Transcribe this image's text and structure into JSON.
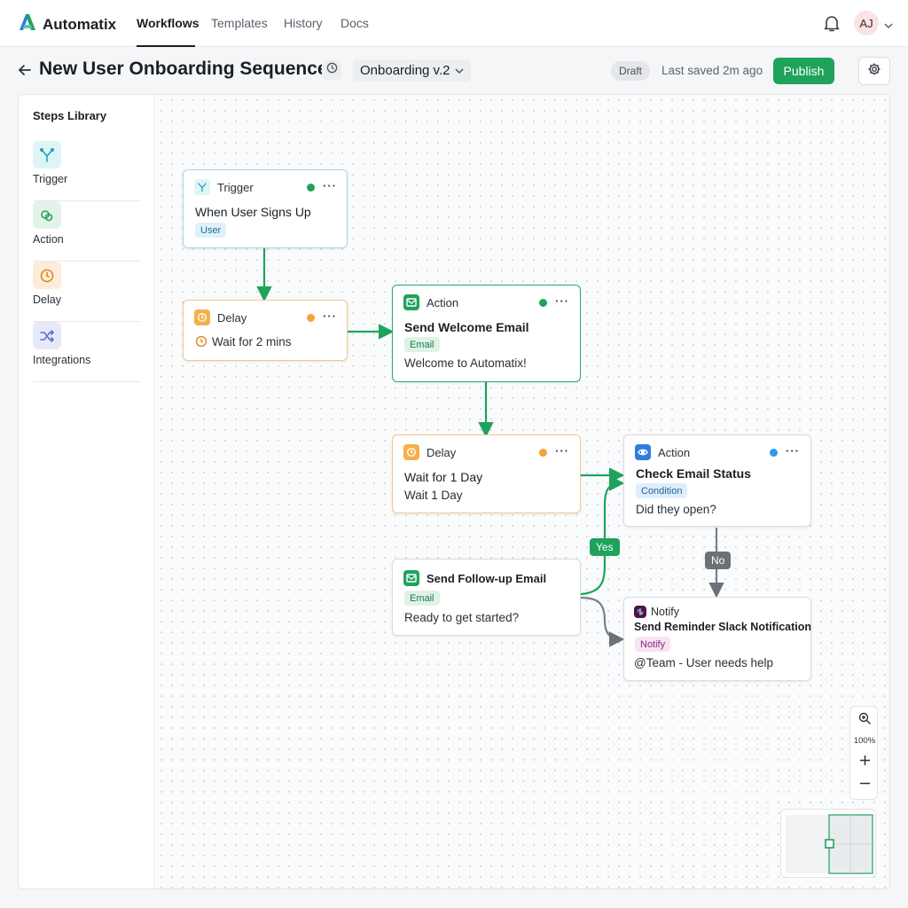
{
  "app": {
    "name": "Automatix",
    "brand_color": "#1fa35b"
  },
  "topnav": {
    "tabs": [
      {
        "label": "Workflows",
        "active": true
      },
      {
        "label": "Templates",
        "active": false
      },
      {
        "label": "History",
        "active": false
      },
      {
        "label": "Docs",
        "active": false
      }
    ],
    "avatar_initials": "AJ"
  },
  "header": {
    "title": "New User Onboarding Sequence",
    "version": "Onboarding v.2",
    "status_badge": "Draft",
    "last_saved": "Last saved 2m ago",
    "publish_label": "Publish"
  },
  "sidebar": {
    "title": "Steps Library",
    "items": [
      {
        "label": "Trigger",
        "icon": "trigger-icon",
        "color": "#1aa6b7"
      },
      {
        "label": "Action",
        "icon": "action-icon",
        "color": "#2e9e5b"
      },
      {
        "label": "Delay",
        "icon": "clock-icon",
        "color": "#d98a1f"
      },
      {
        "label": "Integrations",
        "icon": "shuffle-icon",
        "color": "#5a6ec8"
      }
    ]
  },
  "nodes": {
    "trigger": {
      "type": "Trigger",
      "title": "When User Signs Up",
      "tag": "User",
      "status_color": "#1fa35b"
    },
    "delay1": {
      "type": "Delay",
      "text": "Wait for 2 mins",
      "status_color": "#f5a13c"
    },
    "welcome": {
      "type": "Action",
      "title": "Send Welcome Email",
      "tag": "Email",
      "text": "Welcome to Automatix!",
      "status_color": "#1fa35b"
    },
    "delay2": {
      "type": "Delay",
      "title": "Wait for 1 Day",
      "text": "Wait 1 Day",
      "status_color": "#f5a13c"
    },
    "check": {
      "type": "Action",
      "title": "Check Email Status",
      "tag": "Condition",
      "text": "Did they open?",
      "status_color": "#2f9bea"
    },
    "followup": {
      "title": "Send Follow-up Email",
      "tag": "Email",
      "text": "Ready to get started?"
    },
    "notify": {
      "type": "Notify",
      "title": "Send Reminder Slack Notification",
      "tag": "Notify",
      "text": "@Team - User needs help"
    }
  },
  "edges": {
    "yes_label": "Yes",
    "no_label": "No"
  },
  "zoom": {
    "level": "100%"
  }
}
